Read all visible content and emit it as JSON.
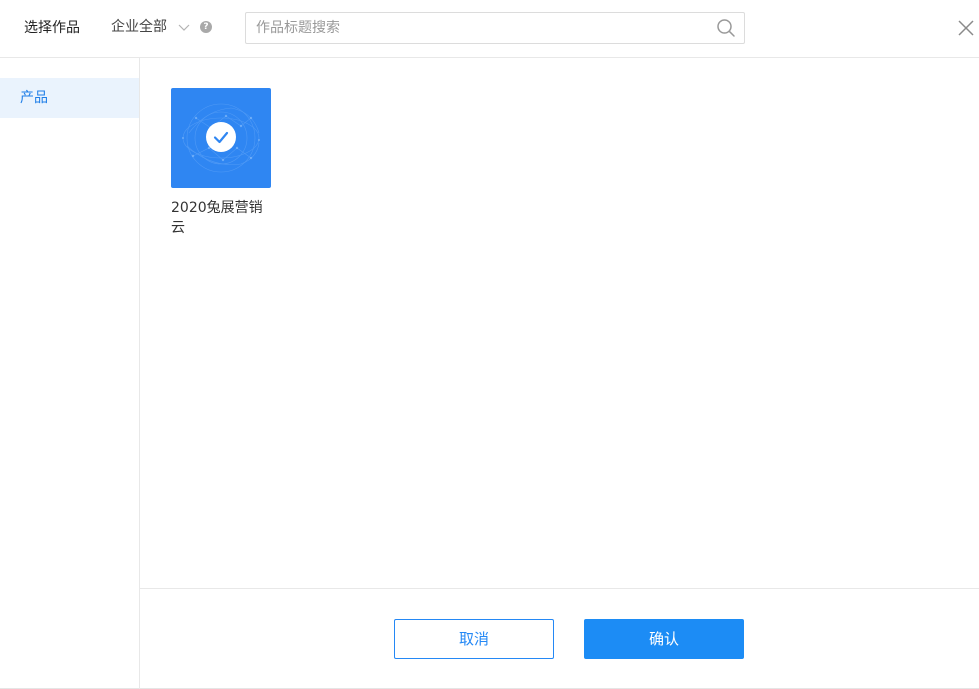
{
  "header": {
    "title": "选择作品",
    "scope_label": "企业全部",
    "help_glyph": "?",
    "search_placeholder": "作品标题搜索",
    "search_value": ""
  },
  "sidebar": {
    "items": [
      {
        "label": "产品",
        "active": true
      }
    ]
  },
  "main": {
    "cards": [
      {
        "title": "2020兔展营销云",
        "selected": true
      }
    ]
  },
  "footer": {
    "cancel_label": "取消",
    "confirm_label": "确认"
  },
  "colors": {
    "accent": "#1c8cf5",
    "active_bg": "#eaf3fd",
    "thumb_bg": "#2f86f2"
  },
  "icons": {
    "chevron": "chevron-down-icon",
    "help": "help-icon",
    "search": "search-icon",
    "close": "close-icon",
    "check": "check-icon"
  }
}
